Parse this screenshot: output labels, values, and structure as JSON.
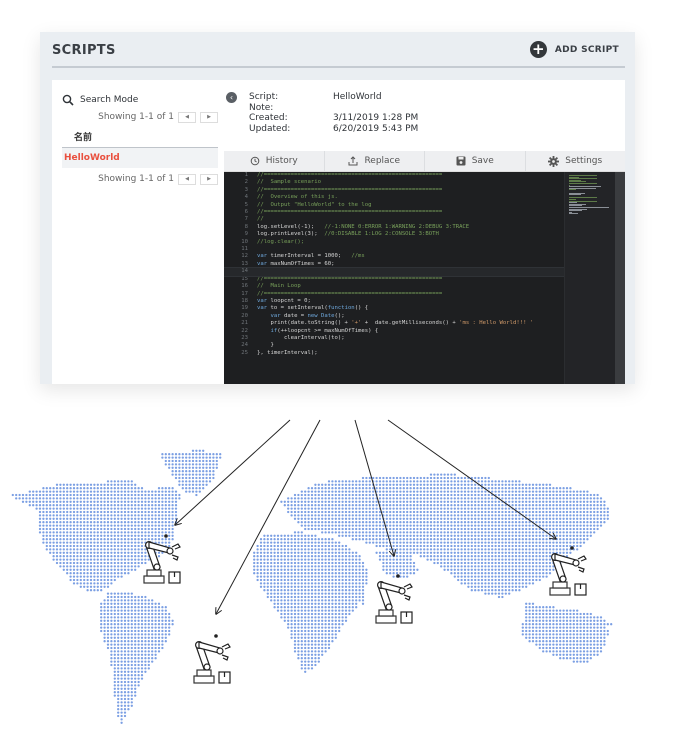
{
  "header": {
    "title": "SCRIPTS",
    "add_script_label": "ADD SCRIPT",
    "add_icon": "plus-circle-icon"
  },
  "sidebar": {
    "search_label": "Search Mode",
    "search_icon": "search-icon",
    "pager_top": "Showing 1-1 of 1",
    "pager_bottom": "Showing 1-1 of 1",
    "prev_icon": "caret-left-icon",
    "next_icon": "caret-right-icon",
    "column_header": "名前",
    "items": [
      {
        "label": "HelloWorld",
        "selected": true
      }
    ]
  },
  "details": {
    "back_icon": "chevron-left-circle-icon",
    "fields": [
      {
        "key": "Script:",
        "value": "HelloWorld"
      },
      {
        "key": "Note:",
        "value": ""
      },
      {
        "key": "Created:",
        "value": "3/11/2019 1:28 PM"
      },
      {
        "key": "Updated:",
        "value": "6/20/2019 5:43 PM"
      }
    ]
  },
  "toolbar": {
    "history": "History",
    "replace": "Replace",
    "save": "Save",
    "settings": "Settings"
  },
  "editor": {
    "current_line": 14,
    "lines": [
      "//=====================================================",
      "//  Sample scenario",
      "//=====================================================",
      "//  Overview of this js.",
      "//  Output \"HelloWorld\" to the log",
      "//=====================================================",
      "//",
      "log.setLevel(-1);   //-1:NONE 0:ERROR 1:WARNING 2:DEBUG 3:TRACE",
      "log.printLevel(3);  //0:DISABLE 1:LOG 2:CONSOLE 3:BOTH",
      "//log.clear();",
      "",
      "var timerInterval = 1000;   //ms",
      "var maxNumOfTimes = 60;",
      "",
      "//=====================================================",
      "//  Main Loop",
      "//=====================================================",
      "var loopcnt = 0;",
      "var to = setInterval(function() {",
      "    var date = new Date();",
      "    print(date.toString() + '+' +  date.getMilliseconds() + 'ms : Hello World!!! '",
      "    if(++loopcnt >= maxNumOfTimes) {",
      "        clearInterval(to);",
      "    }",
      "}, timerInterval);"
    ]
  },
  "map": {
    "dot_color": "#7b9fe3",
    "robots": [
      {
        "name": "north-america"
      },
      {
        "name": "south-america"
      },
      {
        "name": "africa"
      },
      {
        "name": "east-asia"
      }
    ]
  },
  "colors": {
    "accent_red": "#e9503f",
    "panel_bg": "#eaeef2",
    "editor_bg": "#1e1f21"
  }
}
